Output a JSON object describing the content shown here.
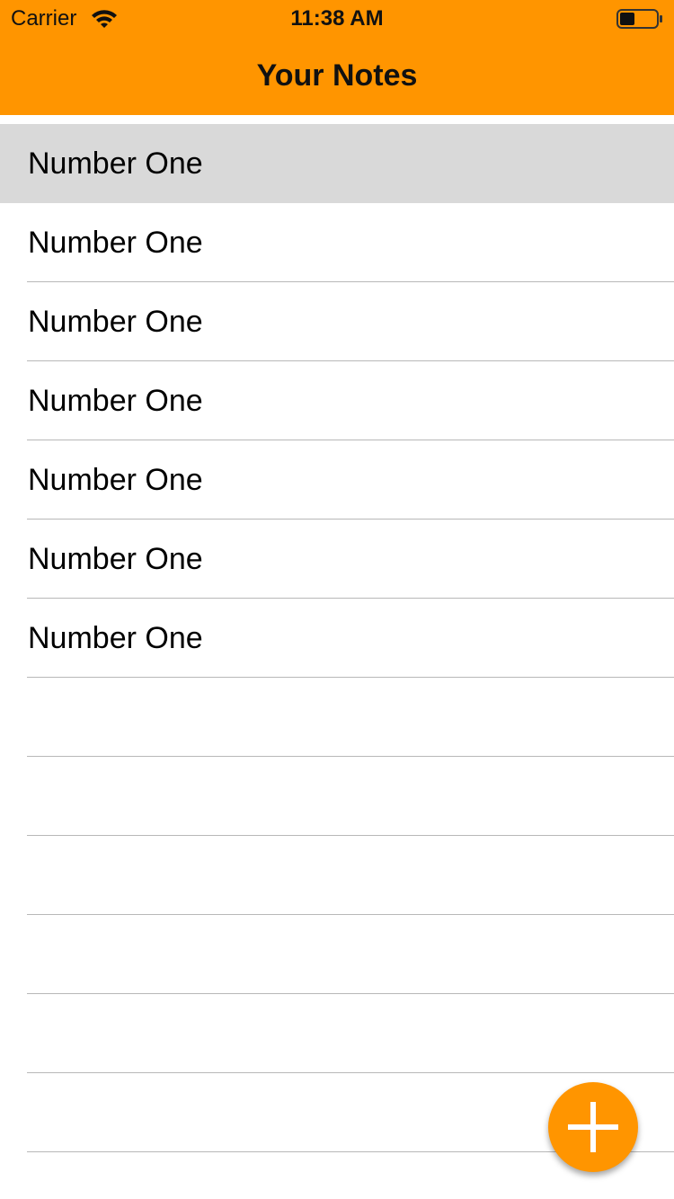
{
  "status_bar": {
    "carrier": "Carrier",
    "time": "11:38 AM",
    "wifi_icon": "wifi-icon",
    "battery_icon": "battery-icon",
    "battery_level_fraction": 0.4
  },
  "nav": {
    "title": "Your Notes",
    "background_color": "#FF9500"
  },
  "notes": [
    {
      "label": "Number One",
      "selected": true
    },
    {
      "label": "Number One",
      "selected": false
    },
    {
      "label": "Number One",
      "selected": false
    },
    {
      "label": "Number One",
      "selected": false
    },
    {
      "label": "Number One",
      "selected": false
    },
    {
      "label": "Number One",
      "selected": false
    },
    {
      "label": "Number One",
      "selected": false
    },
    {
      "label": "",
      "selected": false
    },
    {
      "label": "",
      "selected": false
    },
    {
      "label": "",
      "selected": false
    },
    {
      "label": "",
      "selected": false
    },
    {
      "label": "",
      "selected": false
    },
    {
      "label": "",
      "selected": false
    }
  ],
  "fab": {
    "icon": "plus-icon",
    "color": "#FF9500"
  }
}
